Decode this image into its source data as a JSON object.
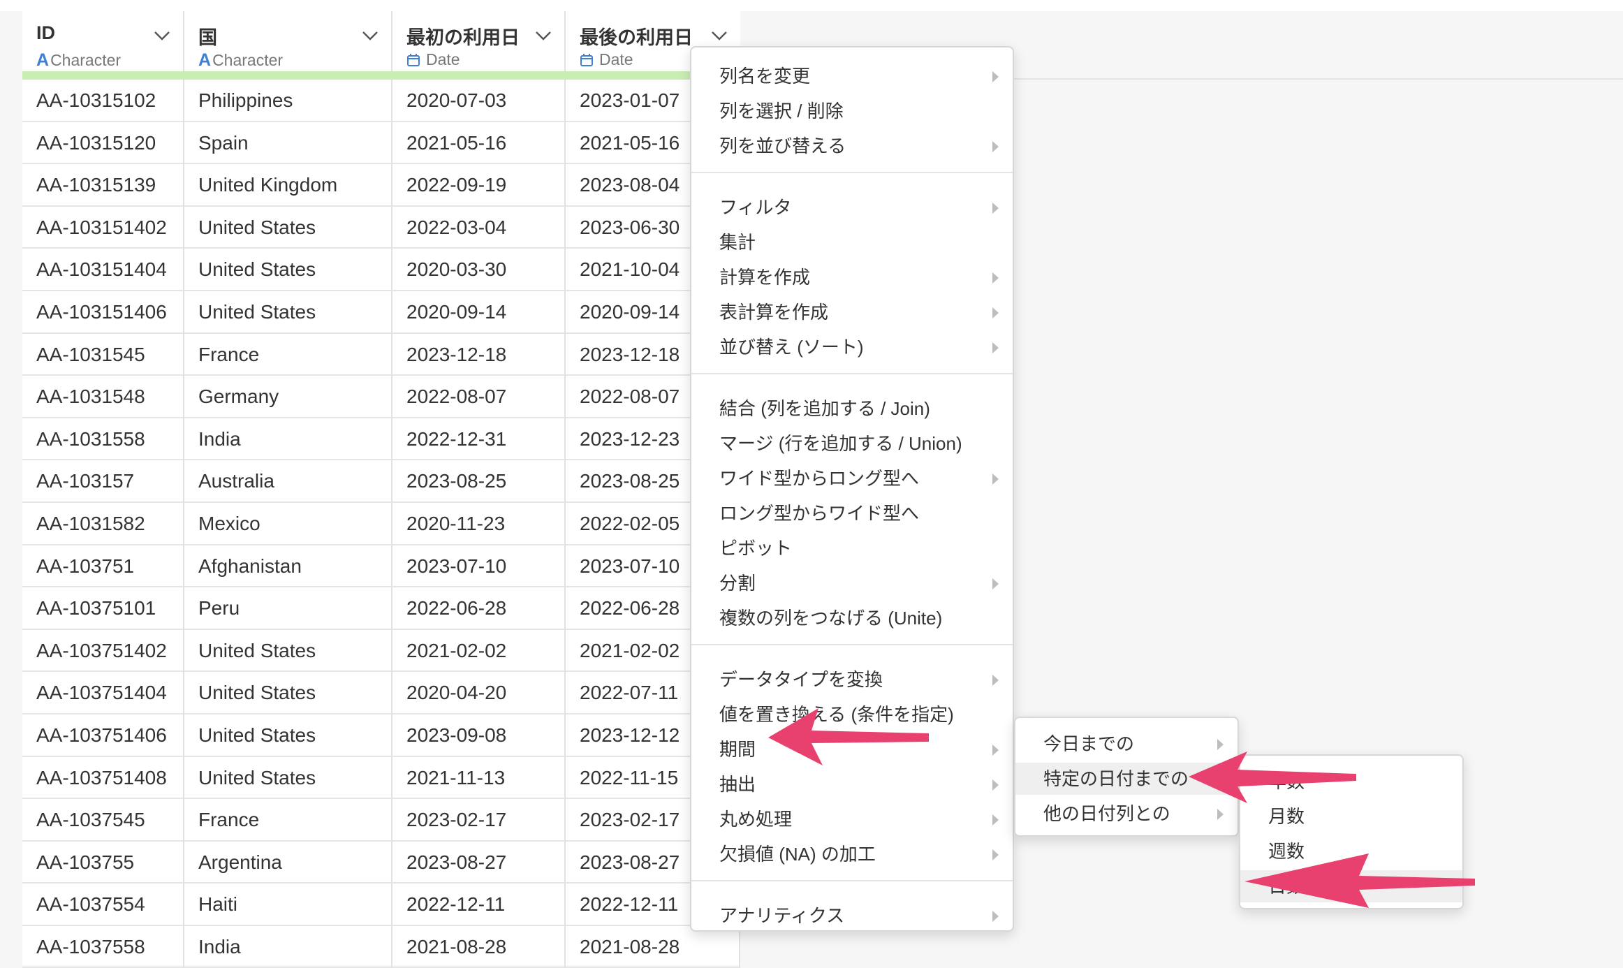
{
  "columns": [
    {
      "name": "ID",
      "type": "Character",
      "type_icon": "character-type-icon"
    },
    {
      "name": "国",
      "type": "Character",
      "type_icon": "character-type-icon"
    },
    {
      "name": "最初の利用日",
      "type": "Date",
      "type_icon": "calendar-icon"
    },
    {
      "name": "最後の利用日",
      "type": "Date",
      "type_icon": "calendar-icon"
    }
  ],
  "rows": [
    [
      "AA-10315102",
      "Philippines",
      "2020-07-03",
      "2023-01-07"
    ],
    [
      "AA-10315120",
      "Spain",
      "2021-05-16",
      "2021-05-16"
    ],
    [
      "AA-10315139",
      "United Kingdom",
      "2022-09-19",
      "2023-08-04"
    ],
    [
      "AA-103151402",
      "United States",
      "2022-03-04",
      "2023-06-30"
    ],
    [
      "AA-103151404",
      "United States",
      "2020-03-30",
      "2021-10-04"
    ],
    [
      "AA-103151406",
      "United States",
      "2020-09-14",
      "2020-09-14"
    ],
    [
      "AA-1031545",
      "France",
      "2023-12-18",
      "2023-12-18"
    ],
    [
      "AA-1031548",
      "Germany",
      "2022-08-07",
      "2022-08-07"
    ],
    [
      "AA-1031558",
      "India",
      "2022-12-31",
      "2023-12-23"
    ],
    [
      "AA-103157",
      "Australia",
      "2023-08-25",
      "2023-08-25"
    ],
    [
      "AA-1031582",
      "Mexico",
      "2020-11-23",
      "2022-02-05"
    ],
    [
      "AA-103751",
      "Afghanistan",
      "2023-07-10",
      "2023-07-10"
    ],
    [
      "AA-10375101",
      "Peru",
      "2022-06-28",
      "2022-06-28"
    ],
    [
      "AA-103751402",
      "United States",
      "2021-02-02",
      "2021-02-02"
    ],
    [
      "AA-103751404",
      "United States",
      "2020-04-20",
      "2022-07-11"
    ],
    [
      "AA-103751406",
      "United States",
      "2023-09-08",
      "2023-12-12"
    ],
    [
      "AA-103751408",
      "United States",
      "2021-11-13",
      "2022-11-15"
    ],
    [
      "AA-1037545",
      "France",
      "2023-02-17",
      "2023-02-17"
    ],
    [
      "AA-103755",
      "Argentina",
      "2023-08-27",
      "2023-08-27"
    ],
    [
      "AA-1037554",
      "Haiti",
      "2022-12-11",
      "2022-12-11"
    ],
    [
      "AA-1037558",
      "India",
      "2021-08-28",
      "2021-08-28"
    ]
  ],
  "menu": {
    "groups": [
      [
        {
          "label": "列名を変更",
          "submenu": true
        },
        {
          "label": "列を選択 / 削除",
          "submenu": false
        },
        {
          "label": "列を並び替える",
          "submenu": true
        }
      ],
      [
        {
          "label": "フィルタ",
          "submenu": true
        },
        {
          "label": "集計",
          "submenu": false
        },
        {
          "label": "計算を作成",
          "submenu": true
        },
        {
          "label": "表計算を作成",
          "submenu": true
        },
        {
          "label": "並び替え (ソート)",
          "submenu": true
        }
      ],
      [
        {
          "label": "結合 (列を追加する / Join)",
          "submenu": false
        },
        {
          "label": "マージ (行を追加する / Union)",
          "submenu": false
        },
        {
          "label": "ワイド型からロング型へ",
          "submenu": true
        },
        {
          "label": "ロング型からワイド型へ",
          "submenu": false
        },
        {
          "label": "ピボット",
          "submenu": false
        },
        {
          "label": "分割",
          "submenu": true
        },
        {
          "label": "複数の列をつなげる (Unite)",
          "submenu": false
        }
      ],
      [
        {
          "label": "データタイプを変換",
          "submenu": true
        },
        {
          "label": "値を置き換える (条件を指定)",
          "submenu": false
        },
        {
          "label": "期間",
          "submenu": true
        },
        {
          "label": "抽出",
          "submenu": true
        },
        {
          "label": "丸め処理",
          "submenu": true
        },
        {
          "label": "欠損値 (NA) の加工",
          "submenu": true
        }
      ],
      [
        {
          "label": "アナリティクス",
          "submenu": true
        }
      ]
    ]
  },
  "submenu_period": [
    {
      "label": "今日までの",
      "submenu": true,
      "highlighted": false
    },
    {
      "label": "特定の日付までの",
      "submenu": true,
      "highlighted": true
    },
    {
      "label": "他の日付列との",
      "submenu": true,
      "highlighted": false
    }
  ],
  "submenu_unit": [
    {
      "label": "年数",
      "highlighted": false
    },
    {
      "label": "月数",
      "highlighted": false
    },
    {
      "label": "週数",
      "highlighted": false
    },
    {
      "label": "日数",
      "highlighted": true
    }
  ],
  "colors": {
    "arrow": "#e8416f",
    "header_stripe": "#c8eeb4",
    "type_accent": "#3f7fd6"
  }
}
